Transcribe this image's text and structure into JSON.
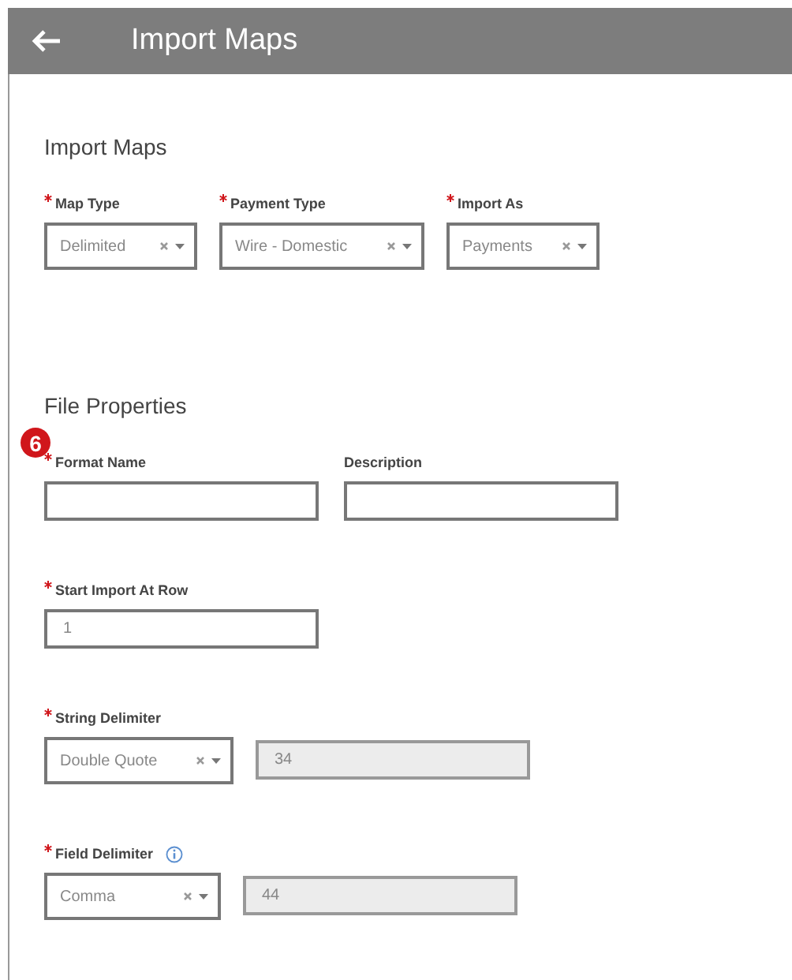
{
  "header": {
    "title": "Import Maps"
  },
  "sections": [
    {
      "title": "Import Maps",
      "rows": [
        [
          {
            "kind": "select",
            "label": "Map Type",
            "required": true,
            "value": "Delimited"
          },
          {
            "kind": "select",
            "label": "Payment Type",
            "required": true,
            "value": "Wire - Domestic"
          },
          {
            "kind": "select",
            "label": "Import As",
            "required": true,
            "value": "Payments"
          }
        ]
      ]
    },
    {
      "title": "File Properties",
      "badge": "6",
      "rows": [
        [
          {
            "kind": "text",
            "label": "Format Name",
            "required": true
          },
          {
            "kind": "text",
            "label": "Description",
            "required": false
          }
        ],
        [
          {
            "kind": "text",
            "label": "Start Import At Row",
            "required": true,
            "value": "1"
          }
        ],
        [
          {
            "kind": "select",
            "label": "String Delimiter",
            "required": true,
            "value": "Double Quote"
          },
          {
            "kind": "readonly",
            "required": false,
            "value": "34"
          }
        ],
        [
          {
            "kind": "select",
            "label": "Field Delimiter",
            "required": true,
            "info": true,
            "value": "Comma"
          },
          {
            "kind": "readonly",
            "required": false,
            "value": "44"
          }
        ]
      ]
    }
  ]
}
